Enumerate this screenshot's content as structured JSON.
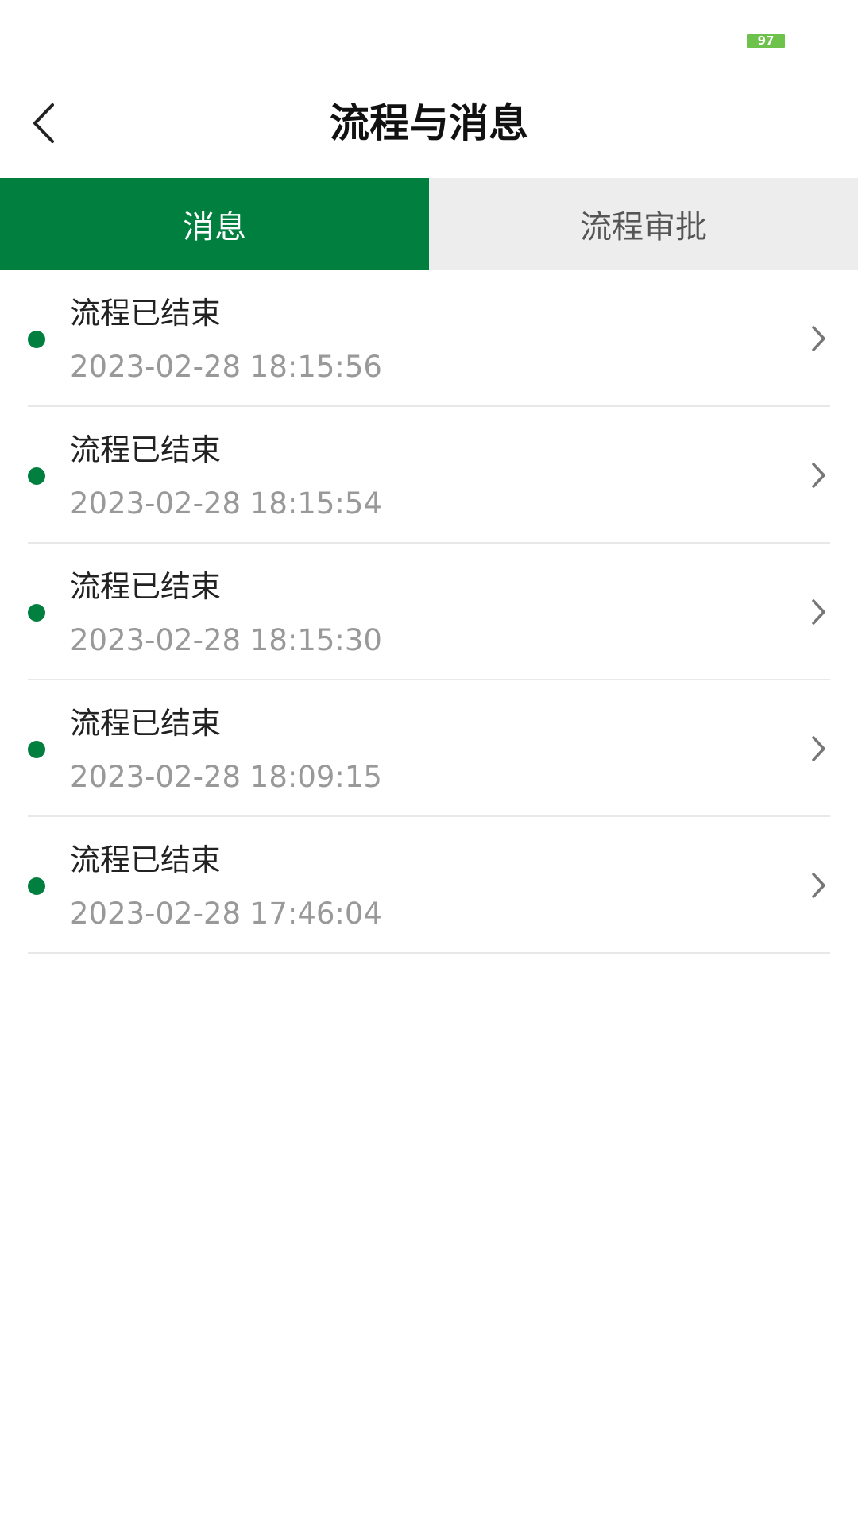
{
  "status_bar": {
    "battery_level": "97"
  },
  "header": {
    "back_icon": "chevron-left-icon",
    "title": "流程与消息"
  },
  "tabs": [
    {
      "label": "消息",
      "active": true
    },
    {
      "label": "流程审批",
      "active": false
    }
  ],
  "colors": {
    "accent": "#007f3e",
    "battery": "#6cc24a",
    "tab_inactive_bg": "#ededed",
    "timestamp": "#999999"
  },
  "messages": [
    {
      "title": "流程已结束",
      "time": "2023-02-28 18:15:56"
    },
    {
      "title": "流程已结束",
      "time": "2023-02-28 18:15:54"
    },
    {
      "title": "流程已结束",
      "time": "2023-02-28 18:15:30"
    },
    {
      "title": "流程已结束",
      "time": "2023-02-28 18:09:15"
    },
    {
      "title": "流程已结束",
      "time": "2023-02-28 17:46:04"
    }
  ]
}
